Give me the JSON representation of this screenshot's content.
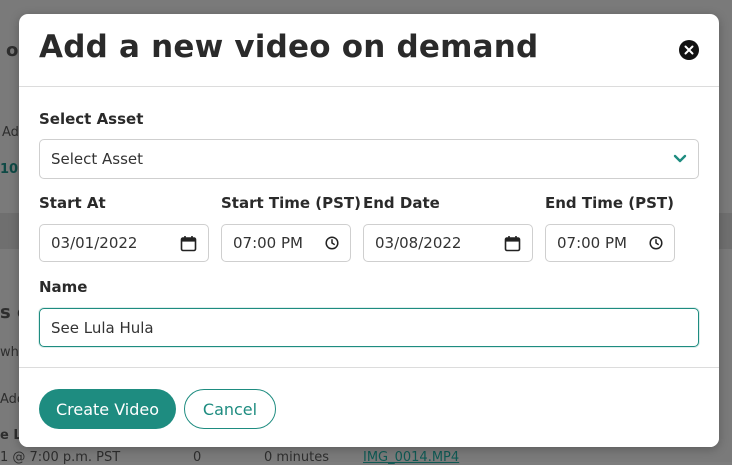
{
  "modal": {
    "title": "Add a new video on demand",
    "close_icon": "close-circle-icon"
  },
  "form": {
    "asset": {
      "label": "Select Asset",
      "value": "Select Asset",
      "icon": "chevron-down-icon"
    },
    "start_at": {
      "label": "Start At",
      "value": "03/01/2022",
      "icon": "calendar-icon"
    },
    "start_time": {
      "label": "Start Time (PST)",
      "value": "07:00 PM",
      "icon": "clock-icon"
    },
    "end_date": {
      "label": "End Date",
      "value": "03/08/2022",
      "icon": "calendar-icon"
    },
    "end_time": {
      "label": "End Time (PST)",
      "value": "07:00 PM",
      "icon": "clock-icon"
    },
    "name": {
      "label": "Name",
      "value": "See Lula Hula"
    }
  },
  "footer": {
    "create_label": "Create Video",
    "cancel_label": "Cancel"
  },
  "background": {
    "fragment_1": "o",
    "fragment_2": "Ad",
    "fragment_3": "10.",
    "fragment_4": "s c",
    "fragment_5": "whe",
    "fragment_6": "Ado",
    "fragment_7": "e L",
    "row_time": "1 @ 7:00 p.m. PST",
    "row_count": "0",
    "row_duration": "0 minutes",
    "row_file": "IMG_0014.MP4"
  },
  "colors": {
    "accent": "#1e8c80",
    "overlay": "#7a7a7a",
    "title": "#2a2a2a"
  }
}
